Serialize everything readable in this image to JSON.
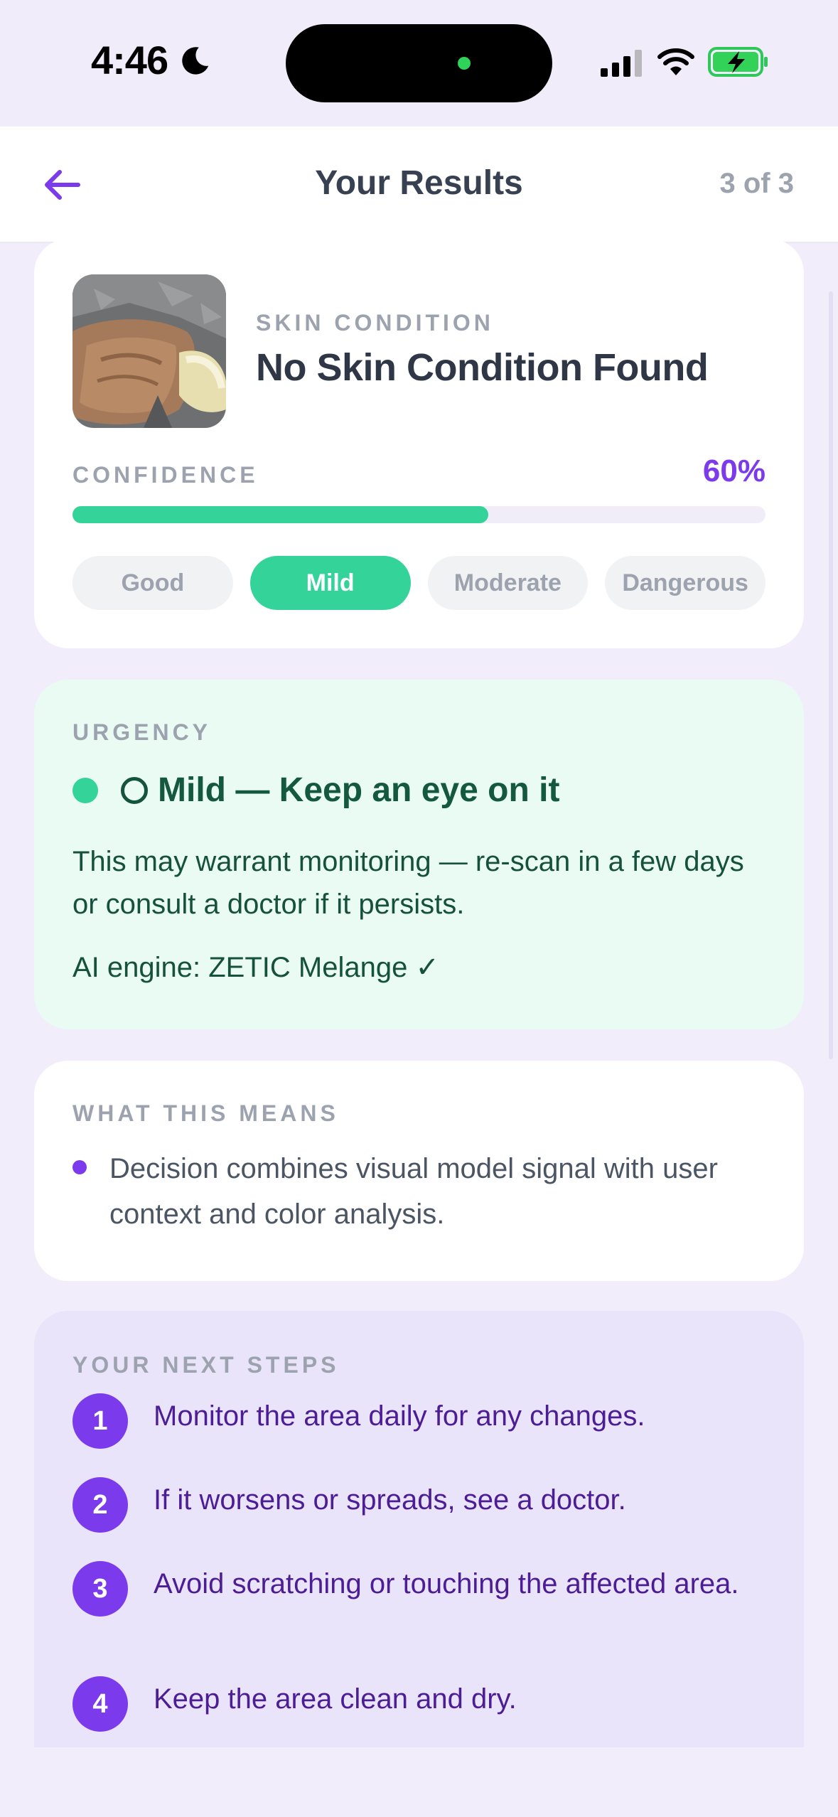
{
  "status_bar": {
    "time": "4:46",
    "moon_icon": "moon-icon",
    "signal_icon": "cellular-signal-icon",
    "wifi_icon": "wifi-icon",
    "battery_icon": "battery-charging-icon"
  },
  "header": {
    "back_icon": "arrow-left-icon",
    "title": "Your Results",
    "step": "3 of 3"
  },
  "result": {
    "condition_label": "SKIN CONDITION",
    "condition_title": "No Skin Condition Found",
    "confidence_label": "CONFIDENCE",
    "confidence_value": "60%",
    "confidence_fraction": 0.6,
    "severity_options": [
      "Good",
      "Mild",
      "Moderate",
      "Dangerous"
    ],
    "selected_severity": "Mild"
  },
  "urgency": {
    "label": "URGENCY",
    "title": "Mild — Keep an eye on it",
    "body": "This may warrant monitoring — re-scan in a few days or consult a doctor if it persists.",
    "engine": "AI engine: ZETIC Melange ✓"
  },
  "meaning": {
    "label": "WHAT THIS MEANS",
    "items": [
      "Decision combines visual model signal with user context and color analysis."
    ]
  },
  "next_steps": {
    "label": "YOUR NEXT STEPS",
    "steps": [
      {
        "num": "1",
        "text": "Monitor the area daily for any changes."
      },
      {
        "num": "2",
        "text": "If it worsens or spreads, see a doctor."
      },
      {
        "num": "3",
        "text": "Avoid scratching or touching the affected area."
      },
      {
        "num": "4",
        "text": "Keep the area clean and dry."
      }
    ]
  },
  "colors": {
    "accent": "#7c3aed",
    "success": "#34d399",
    "urgency_bg": "#e9fbf3",
    "steps_bg": "#e9e4f9"
  }
}
